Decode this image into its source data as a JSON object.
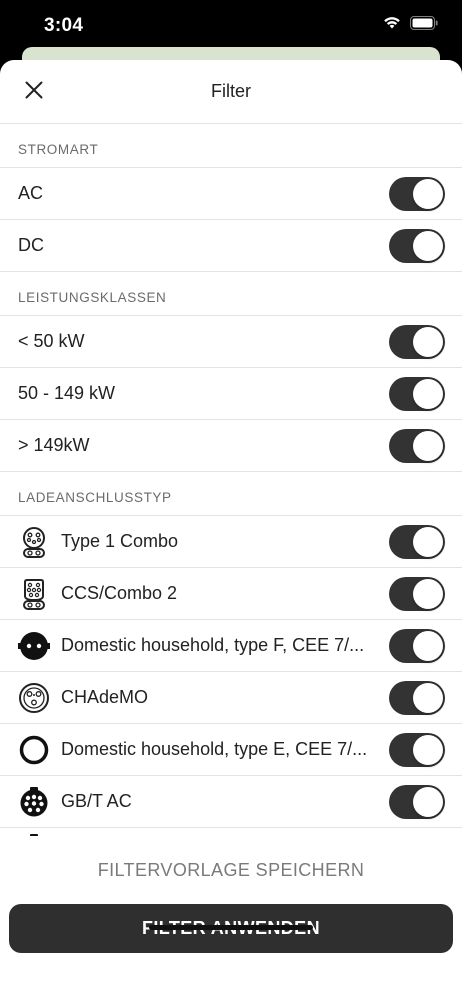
{
  "status_bar": {
    "time": "3:04",
    "icons": [
      "wifi-icon",
      "battery-icon"
    ]
  },
  "header": {
    "title": "Filter",
    "close_icon": "close-icon"
  },
  "sections": {
    "stromart": {
      "title": "STROMART",
      "items": [
        {
          "label": "AC",
          "enabled": true
        },
        {
          "label": "DC",
          "enabled": true
        }
      ]
    },
    "leistungsklassen": {
      "title": "LEISTUNGSKLASSEN",
      "items": [
        {
          "label": "< 50 kW",
          "enabled": true
        },
        {
          "label": "50 - 149 kW",
          "enabled": true
        },
        {
          "label": "> 149kW",
          "enabled": true
        }
      ]
    },
    "ladeanschlusstyp": {
      "title": "LADEANSCHLUSSTYP",
      "items": [
        {
          "label": "Type 1 Combo",
          "icon": "type1-combo-connector-icon",
          "enabled": true
        },
        {
          "label": "CCS/Combo 2",
          "icon": "ccs-combo2-connector-icon",
          "enabled": true
        },
        {
          "label": "Domestic household, type F, CEE 7/...",
          "icon": "schuko-type-f-connector-icon",
          "enabled": true
        },
        {
          "label": "CHAdeMO",
          "icon": "chademo-connector-icon",
          "enabled": true
        },
        {
          "label": "Domestic household, type E, CEE 7/...",
          "icon": "type-e-connector-icon",
          "enabled": true
        },
        {
          "label": "GB/T AC",
          "icon": "gbt-ac-connector-icon",
          "enabled": true
        }
      ]
    }
  },
  "footer": {
    "save_template_label": "FILTERVORLAGE SPEICHERN",
    "apply_label": "FILTER ANWENDEN"
  },
  "colors": {
    "toggle_on": "#333333",
    "apply_button": "#2f2f2f",
    "section_text": "#6b6b6b"
  }
}
